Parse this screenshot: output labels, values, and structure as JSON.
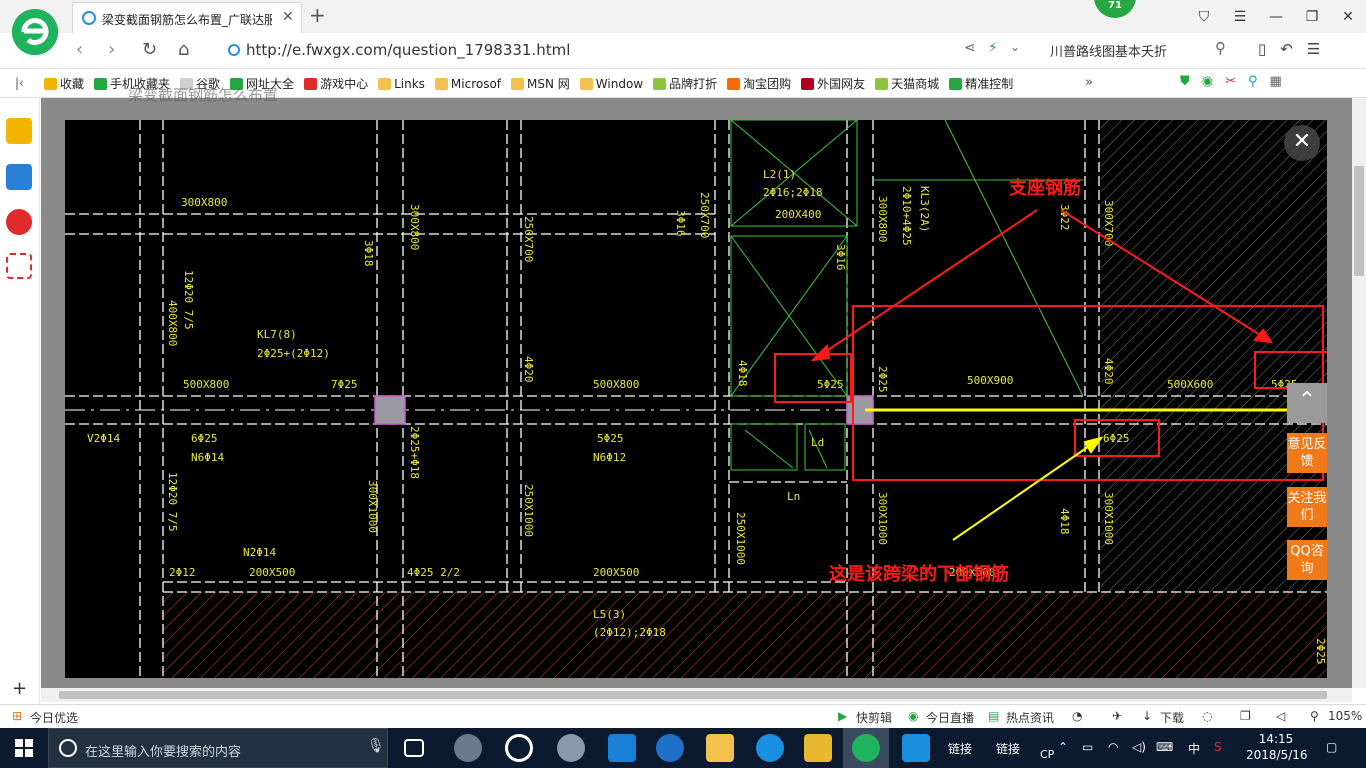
{
  "browser": {
    "tab_title": "梁变截面钢筋怎么布置_广联达服",
    "notification_count": "71",
    "url": "http://e.fwxgx.com/question_1798331.html",
    "search_text": "川普路线图基本夭折",
    "page_header": "梁变截面钢筋怎么布置"
  },
  "bookmarks": [
    {
      "label": "收藏",
      "color": "#f5b400"
    },
    {
      "label": "手机收藏夹",
      "color": "#27a744"
    },
    {
      "label": "谷歌",
      "color": "#d0d0d0"
    },
    {
      "label": "网址大全",
      "color": "#27a744"
    },
    {
      "label": "游戏中心",
      "color": "#e02b2b"
    },
    {
      "label": "Links",
      "color": "#f2c14e"
    },
    {
      "label": "Microsof",
      "color": "#f2c14e"
    },
    {
      "label": "MSN 网",
      "color": "#f2c14e"
    },
    {
      "label": "Window",
      "color": "#f2c14e"
    },
    {
      "label": "品牌打折",
      "color": "#8cc63f"
    },
    {
      "label": "淘宝团购",
      "color": "#ff6a00"
    },
    {
      "label": "外国网友",
      "color": "#b00020"
    },
    {
      "label": "天猫商城",
      "color": "#8cc63f"
    },
    {
      "label": "精准控制",
      "color": "#27a744"
    }
  ],
  "viewer": {
    "feedback_label": "意见反馈",
    "follow_label": "关注我们",
    "qq_label": "QQ咨询",
    "back_top_icon": "arrow-up-icon"
  },
  "cad_drawing": {
    "annotation_support": "支座钢筋",
    "annotation_bottom": "这是该跨梁的下部钢筋",
    "labels": [
      {
        "id": "l1",
        "text": "300X800"
      },
      {
        "id": "l2",
        "text": "400X800"
      },
      {
        "id": "l3",
        "text": "12Φ20 7/5"
      },
      {
        "id": "l4",
        "text": "KL7(8)"
      },
      {
        "id": "l5",
        "text": "2Φ25+(2Φ12)"
      },
      {
        "id": "l6",
        "text": "500X800"
      },
      {
        "id": "l7",
        "text": "7Φ25"
      },
      {
        "id": "l8",
        "text": "300X800"
      },
      {
        "id": "l9",
        "text": "3Φ18"
      },
      {
        "id": "l10",
        "text": "250X700"
      },
      {
        "id": "l11",
        "text": "4Φ20"
      },
      {
        "id": "l12",
        "text": "500X800"
      },
      {
        "id": "l13",
        "text": "3Φ16"
      },
      {
        "id": "l14",
        "text": "250X700"
      },
      {
        "id": "l15",
        "text": "L2(1)"
      },
      {
        "id": "l16",
        "text": "2Φ16;2Φ18"
      },
      {
        "id": "l17",
        "text": "200X400"
      },
      {
        "id": "l18",
        "text": "4Φ18"
      },
      {
        "id": "l19",
        "text": "5Φ25"
      },
      {
        "id": "l20",
        "text": "3Φ16"
      },
      {
        "id": "l21",
        "text": "KL3(2A)"
      },
      {
        "id": "l22",
        "text": "2Φ10+4Φ25"
      },
      {
        "id": "l23",
        "text": "300X800"
      },
      {
        "id": "l24",
        "text": "2Φ25"
      },
      {
        "id": "l25",
        "text": "500X900"
      },
      {
        "id": "l26",
        "text": "3Φ22"
      },
      {
        "id": "l27",
        "text": "300X700"
      },
      {
        "id": "l28",
        "text": "4Φ20"
      },
      {
        "id": "l29",
        "text": "500X600"
      },
      {
        "id": "l30",
        "text": "5Φ25"
      },
      {
        "id": "l31",
        "text": "V2Φ14"
      },
      {
        "id": "l32",
        "text": "6Φ25"
      },
      {
        "id": "l33",
        "text": "N6Φ14"
      },
      {
        "id": "l34",
        "text": "2Φ25+Φ18"
      },
      {
        "id": "l35",
        "text": "5Φ25"
      },
      {
        "id": "l36",
        "text": "N6Φ12"
      },
      {
        "id": "l37",
        "text": "6Φ25"
      },
      {
        "id": "l38",
        "text": "12Φ20 7/5"
      },
      {
        "id": "l39",
        "text": "300X1000"
      },
      {
        "id": "l40",
        "text": "250X1000"
      },
      {
        "id": "l41",
        "text": "250X1000"
      },
      {
        "id": "l42",
        "text": "300X1000"
      },
      {
        "id": "l43",
        "text": "4Φ18"
      },
      {
        "id": "l44",
        "text": "300X1000"
      },
      {
        "id": "l45",
        "text": "N2Φ14"
      },
      {
        "id": "l46",
        "text": "2Φ12"
      },
      {
        "id": "l47",
        "text": "200X500"
      },
      {
        "id": "l48",
        "text": "4Φ25 2/2"
      },
      {
        "id": "l49",
        "text": "200X500"
      },
      {
        "id": "l50",
        "text": "200X500"
      },
      {
        "id": "l51",
        "text": "L5(3)"
      },
      {
        "id": "l52",
        "text": "(2Φ12);2Φ18"
      },
      {
        "id": "l53",
        "text": "Ln"
      },
      {
        "id": "l54",
        "text": "Ld"
      },
      {
        "id": "l55",
        "text": "2Φ25"
      }
    ]
  },
  "statusbar": {
    "left": "今日优选",
    "kuaijianji": "快剪辑",
    "live": "今日直播",
    "news": "热点资讯",
    "download": "下载",
    "zoom": "105%"
  },
  "taskbar": {
    "search_placeholder": "在这里输入你要搜索的内容",
    "link1": "链接",
    "link2": "链接",
    "ime": "CP",
    "lang": "中",
    "time": "14:15",
    "date": "2018/5/16"
  }
}
